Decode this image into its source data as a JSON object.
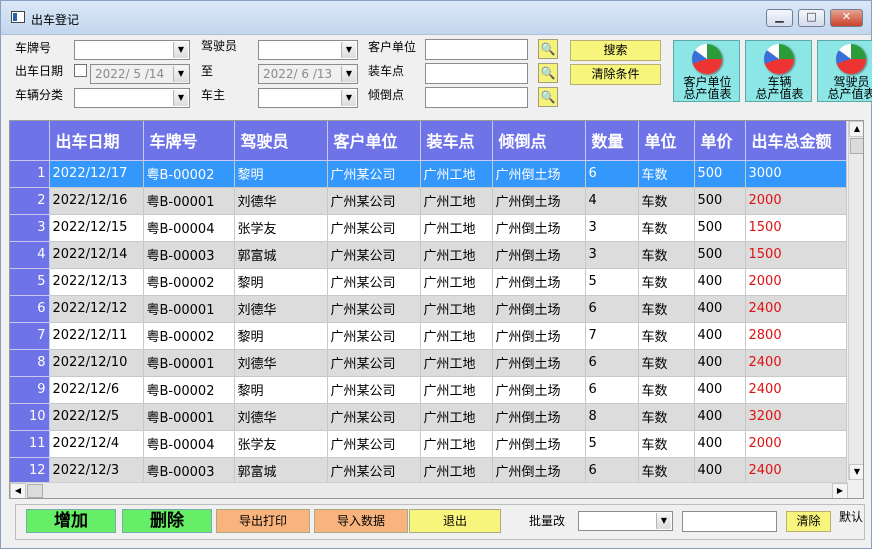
{
  "window": {
    "title": "出车登记",
    "min_label": "▁",
    "max_label": "□",
    "close_label": "✕"
  },
  "filters": {
    "plate_label": "车牌号",
    "date_label": "出车日期",
    "category_label": "车辆分类",
    "driver_label": "驾驶员",
    "to_label": "至",
    "owner_label": "车主",
    "customer_label": "客户单位",
    "loading_label": "装车点",
    "dump_label": "倾倒点",
    "date_from": "2022/ 5 /14",
    "date_to": "2022/ 6 /13"
  },
  "buttons": {
    "search": "搜索",
    "clear_filters": "清除条件",
    "add": "增加",
    "delete": "删除",
    "export_print": "导出打印",
    "import_data": "导入数据",
    "exit": "退出",
    "batch_label": "批量改",
    "clear": "清除",
    "default_label": "默认"
  },
  "reports": [
    {
      "line1": "客户单位",
      "line2": "总产值表"
    },
    {
      "line1": "车辆",
      "line2": "总产值表"
    },
    {
      "line1": "驾驶员",
      "line2": "总产值表"
    }
  ],
  "table": {
    "columns": [
      "出车日期",
      "车牌号",
      "驾驶员",
      "客户单位",
      "装车点",
      "倾倒点",
      "数量",
      "单位",
      "单价",
      "出车总金额"
    ],
    "rows": [
      {
        "n": "1",
        "date": "2022/12/17",
        "plate": "粤B-00002",
        "driver": "黎明",
        "customer": "广州某公司",
        "loading": "广州工地",
        "dump": "广州倒土场",
        "qty": "6",
        "unit": "车数",
        "price": "500",
        "total": "3000"
      },
      {
        "n": "2",
        "date": "2022/12/16",
        "plate": "粤B-00001",
        "driver": "刘德华",
        "customer": "广州某公司",
        "loading": "广州工地",
        "dump": "广州倒土场",
        "qty": "4",
        "unit": "车数",
        "price": "500",
        "total": "2000"
      },
      {
        "n": "3",
        "date": "2022/12/15",
        "plate": "粤B-00004",
        "driver": "张学友",
        "customer": "广州某公司",
        "loading": "广州工地",
        "dump": "广州倒土场",
        "qty": "3",
        "unit": "车数",
        "price": "500",
        "total": "1500"
      },
      {
        "n": "4",
        "date": "2022/12/14",
        "plate": "粤B-00003",
        "driver": "郭富城",
        "customer": "广州某公司",
        "loading": "广州工地",
        "dump": "广州倒土场",
        "qty": "3",
        "unit": "车数",
        "price": "500",
        "total": "1500"
      },
      {
        "n": "5",
        "date": "2022/12/13",
        "plate": "粤B-00002",
        "driver": "黎明",
        "customer": "广州某公司",
        "loading": "广州工地",
        "dump": "广州倒土场",
        "qty": "5",
        "unit": "车数",
        "price": "400",
        "total": "2000"
      },
      {
        "n": "6",
        "date": "2022/12/12",
        "plate": "粤B-00001",
        "driver": "刘德华",
        "customer": "广州某公司",
        "loading": "广州工地",
        "dump": "广州倒土场",
        "qty": "6",
        "unit": "车数",
        "price": "400",
        "total": "2400"
      },
      {
        "n": "7",
        "date": "2022/12/11",
        "plate": "粤B-00002",
        "driver": "黎明",
        "customer": "广州某公司",
        "loading": "广州工地",
        "dump": "广州倒土场",
        "qty": "7",
        "unit": "车数",
        "price": "400",
        "total": "2800"
      },
      {
        "n": "8",
        "date": "2022/12/10",
        "plate": "粤B-00001",
        "driver": "刘德华",
        "customer": "广州某公司",
        "loading": "广州工地",
        "dump": "广州倒土场",
        "qty": "6",
        "unit": "车数",
        "price": "400",
        "total": "2400"
      },
      {
        "n": "9",
        "date": "2022/12/6",
        "plate": "粤B-00002",
        "driver": "黎明",
        "customer": "广州某公司",
        "loading": "广州工地",
        "dump": "广州倒土场",
        "qty": "6",
        "unit": "车数",
        "price": "400",
        "total": "2400"
      },
      {
        "n": "10",
        "date": "2022/12/5",
        "plate": "粤B-00001",
        "driver": "刘德华",
        "customer": "广州某公司",
        "loading": "广州工地",
        "dump": "广州倒土场",
        "qty": "8",
        "unit": "车数",
        "price": "400",
        "total": "3200"
      },
      {
        "n": "11",
        "date": "2022/12/4",
        "plate": "粤B-00004",
        "driver": "张学友",
        "customer": "广州某公司",
        "loading": "广州工地",
        "dump": "广州倒土场",
        "qty": "5",
        "unit": "车数",
        "price": "400",
        "total": "2000"
      },
      {
        "n": "12",
        "date": "2022/12/3",
        "plate": "粤B-00003",
        "driver": "郭富城",
        "customer": "广州某公司",
        "loading": "广州工地",
        "dump": "广州倒土场",
        "qty": "6",
        "unit": "车数",
        "price": "400",
        "total": "2400"
      }
    ]
  },
  "colors": {
    "header_bg": "#6f73e8",
    "selected_row": "#3397fb",
    "alt_row": "#dcdcdc",
    "amount_red": "#e01010",
    "add_btn": "#66ee66",
    "orange_btn": "#f9b47e",
    "yellow_btn": "#f8f57d"
  }
}
